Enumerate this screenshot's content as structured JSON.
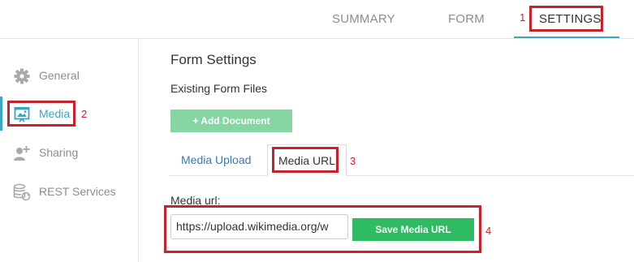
{
  "topnav": {
    "tabs": [
      {
        "label": "SUMMARY"
      },
      {
        "label": "FORM"
      },
      {
        "label": "SETTINGS",
        "active": true
      }
    ]
  },
  "annotations": {
    "m1": "1",
    "m2": "2",
    "m3": "3",
    "m4": "4"
  },
  "sidebar": {
    "items": [
      {
        "label": "General",
        "icon": "gear-icon"
      },
      {
        "label": "Media",
        "icon": "media-icon",
        "active": true
      },
      {
        "label": "Sharing",
        "icon": "add-user-icon"
      },
      {
        "label": "REST Services",
        "icon": "database-sync-icon"
      }
    ]
  },
  "main": {
    "title": "Form Settings",
    "subtitle": "Existing Form Files",
    "add_document_label": "+ Add Document",
    "tabs": [
      {
        "label": "Media Upload"
      },
      {
        "label": "Media URL",
        "active": true
      }
    ],
    "media_url_label": "Media url:",
    "media_url_value": "https://upload.wikimedia.org/w",
    "save_button_label": "Save Media URL"
  },
  "colors": {
    "accent": "#3aa6c2",
    "annotation_red": "#c8232c",
    "save_green": "#2ebb62",
    "add_doc_green": "#86d6a3",
    "link_blue": "#337ab7"
  }
}
